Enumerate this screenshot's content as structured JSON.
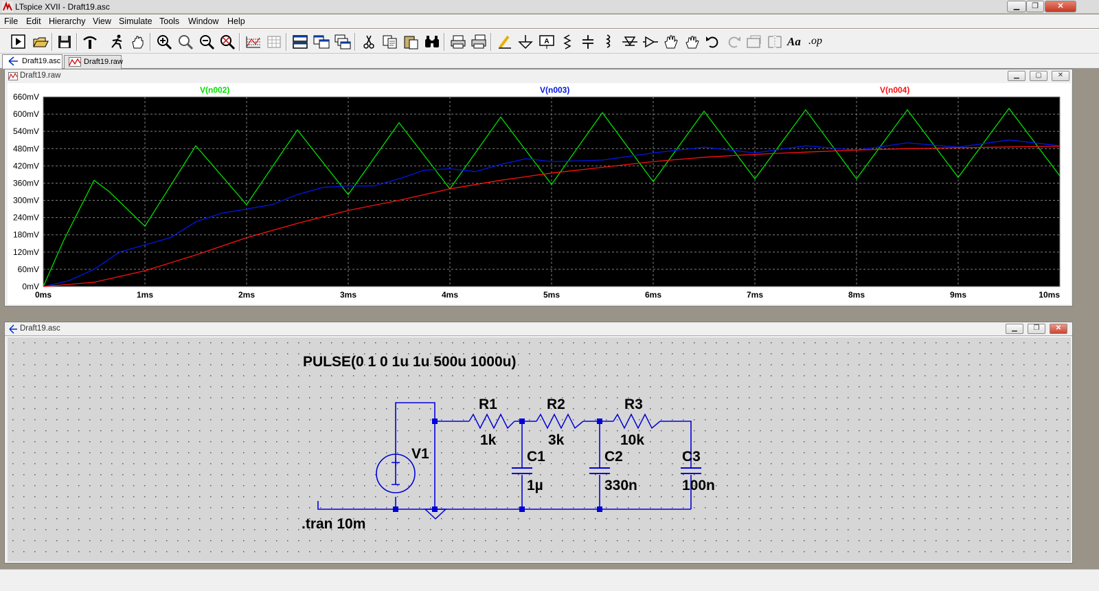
{
  "window": {
    "title": "LTspice XVII - Draft19.asc"
  },
  "menu": [
    "File",
    "Edit",
    "Hierarchy",
    "View",
    "Simulate",
    "Tools",
    "Window",
    "Help"
  ],
  "toolbar_icons": [
    "run-icon",
    "open-icon",
    "save-icon",
    "control-panel-icon",
    "run-man-icon",
    "pan-hand-icon",
    "zoom-in-icon",
    "zoom-area-icon",
    "zoom-out-icon",
    "zoom-fit-icon",
    "autorange-icon",
    "grid-icon",
    "tile-horizontal-icon",
    "tile-vertical-icon",
    "cascade-icon",
    "cut-icon",
    "copy-icon",
    "paste-icon",
    "find-icon",
    "print-icon",
    "print-setup-icon",
    "wire-icon",
    "ground-icon",
    "label-net-icon",
    "resistor-icon",
    "capacitor-icon",
    "inductor-icon",
    "diode-icon",
    "component-icon",
    "move-icon",
    "drag-icon",
    "undo-icon",
    "redo-icon",
    "rotate-icon",
    "mirror-icon",
    "text-icon",
    "spice-directive-icon"
  ],
  "toolbar_text": {
    "text_button": "Aa",
    "op_button": ".op"
  },
  "tabs": [
    {
      "label": "Draft19.asc",
      "active": true
    },
    {
      "label": "Draft19.raw",
      "active": false
    }
  ],
  "plot_window": {
    "title": "Draft19.raw"
  },
  "schematic_window": {
    "title": "Draft19.asc"
  },
  "colors": {
    "v002": "#00e000",
    "v003": "#0018e8",
    "v004": "#ff1010",
    "wire": "#0000d8",
    "plot_bg": "#000000",
    "grid": "#808080"
  },
  "chart_data": {
    "type": "line",
    "x_ticks": [
      "0ms",
      "1ms",
      "2ms",
      "3ms",
      "4ms",
      "5ms",
      "6ms",
      "7ms",
      "8ms",
      "9ms",
      "10ms"
    ],
    "y_ticks": [
      "0mV",
      "60mV",
      "120mV",
      "180mV",
      "240mV",
      "300mV",
      "360mV",
      "420mV",
      "480mV",
      "540mV",
      "600mV",
      "660mV"
    ],
    "xlim": [
      0,
      10
    ],
    "ylim": [
      0,
      660
    ],
    "grid": true,
    "legend": "top",
    "series": [
      {
        "name": "V(n002)",
        "color": "#00e000",
        "x": [
          0,
          0.2,
          0.5,
          0.65,
          1.0,
          1.5,
          2.0,
          2.5,
          3.0,
          3.5,
          4.0,
          4.5,
          5.0,
          5.5,
          6.0,
          6.5,
          7.0,
          7.5,
          8.0,
          8.5,
          9.0,
          9.5,
          10.0
        ],
        "y": [
          0,
          160,
          370,
          330,
          210,
          490,
          285,
          545,
          320,
          570,
          340,
          590,
          355,
          605,
          365,
          610,
          375,
          615,
          375,
          615,
          380,
          620,
          385
        ]
      },
      {
        "name": "V(n003)",
        "color": "#0018e8",
        "x": [
          0,
          0.25,
          0.5,
          0.75,
          1.0,
          1.25,
          1.5,
          1.75,
          2.0,
          2.25,
          2.5,
          2.75,
          3.0,
          3.25,
          3.5,
          3.75,
          4.0,
          4.25,
          4.5,
          4.75,
          5.0,
          5.5,
          6.0,
          6.5,
          7.0,
          7.5,
          8.0,
          8.5,
          9.0,
          9.5,
          10.0
        ],
        "y": [
          0,
          20,
          60,
          120,
          145,
          170,
          225,
          255,
          270,
          285,
          320,
          345,
          350,
          350,
          375,
          405,
          410,
          400,
          425,
          445,
          435,
          440,
          465,
          485,
          465,
          490,
          475,
          500,
          485,
          510,
          490
        ]
      },
      {
        "name": "V(n004)",
        "color": "#ff1010",
        "x": [
          0,
          0.5,
          1.0,
          1.5,
          2.0,
          2.5,
          3.0,
          3.5,
          4.0,
          4.5,
          5.0,
          5.5,
          6.0,
          6.5,
          7.0,
          7.5,
          8.0,
          8.5,
          9.0,
          9.5,
          10.0
        ],
        "y": [
          0,
          15,
          55,
          110,
          170,
          220,
          265,
          300,
          340,
          370,
          395,
          415,
          435,
          450,
          460,
          468,
          475,
          480,
          483,
          486,
          488
        ]
      }
    ]
  },
  "schematic": {
    "source_value": "PULSE(0 1 0 1u 1u 500u 1000u)",
    "directive": ".tran 10m",
    "source_name": "V1",
    "resistors": [
      {
        "name": "R1",
        "value": "1k"
      },
      {
        "name": "R2",
        "value": "3k"
      },
      {
        "name": "R3",
        "value": "10k"
      }
    ],
    "capacitors": [
      {
        "name": "C1",
        "value": "1µ"
      },
      {
        "name": "C2",
        "value": "330n"
      },
      {
        "name": "C3",
        "value": "100n"
      }
    ]
  }
}
